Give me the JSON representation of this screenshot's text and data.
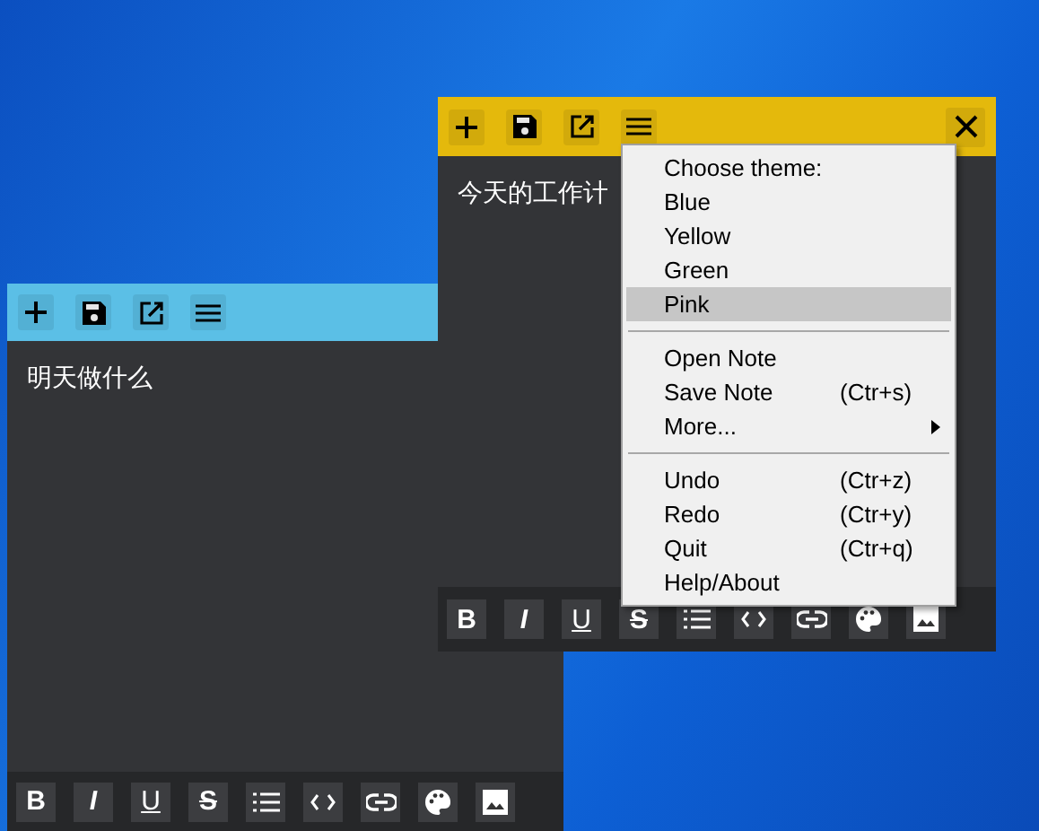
{
  "notes": [
    {
      "color": "#5bbfe6",
      "text": "明天做什么",
      "header_buttons": [
        {
          "kind": "add"
        },
        {
          "kind": "save"
        },
        {
          "kind": "open"
        },
        {
          "kind": "menu"
        }
      ],
      "toolbar": [
        {
          "kind": "bold",
          "glyph": "B"
        },
        {
          "kind": "italic",
          "glyph": "I"
        },
        {
          "kind": "underline",
          "glyph": "U"
        },
        {
          "kind": "strike",
          "glyph": "S"
        },
        {
          "kind": "list"
        },
        {
          "kind": "code"
        },
        {
          "kind": "link"
        },
        {
          "kind": "palette"
        },
        {
          "kind": "image"
        }
      ]
    },
    {
      "color": "#e4b90c",
      "text": "今天的工作计",
      "header_buttons": [
        {
          "kind": "add"
        },
        {
          "kind": "save"
        },
        {
          "kind": "open"
        },
        {
          "kind": "menu"
        },
        {
          "kind": "close"
        }
      ],
      "toolbar": [
        {
          "kind": "bold",
          "glyph": "B"
        },
        {
          "kind": "italic",
          "glyph": "I"
        },
        {
          "kind": "underline",
          "glyph": "U"
        },
        {
          "kind": "strike",
          "glyph": "S"
        },
        {
          "kind": "list"
        },
        {
          "kind": "code"
        },
        {
          "kind": "link"
        },
        {
          "kind": "palette"
        },
        {
          "kind": "image"
        }
      ],
      "menu": {
        "items": [
          {
            "kind": "header",
            "label": "Choose theme:"
          },
          {
            "kind": "option",
            "label": "Blue",
            "selected": false
          },
          {
            "kind": "option",
            "label": "Yellow",
            "selected": false
          },
          {
            "kind": "option",
            "label": "Green",
            "selected": false
          },
          {
            "kind": "option",
            "label": "Pink",
            "selected": true
          },
          {
            "kind": "separator"
          },
          {
            "kind": "item",
            "label": "Open Note"
          },
          {
            "kind": "item",
            "label": "Save Note",
            "shortcut": "(Ctr+s)"
          },
          {
            "kind": "submenu",
            "label": "More..."
          },
          {
            "kind": "separator"
          },
          {
            "kind": "item",
            "label": "Undo",
            "shortcut": "(Ctr+z)"
          },
          {
            "kind": "item",
            "label": "Redo",
            "shortcut": "(Ctr+y)"
          },
          {
            "kind": "item",
            "label": "Quit",
            "shortcut": "(Ctr+q)"
          },
          {
            "kind": "item",
            "label": "Help/About"
          }
        ]
      }
    }
  ]
}
